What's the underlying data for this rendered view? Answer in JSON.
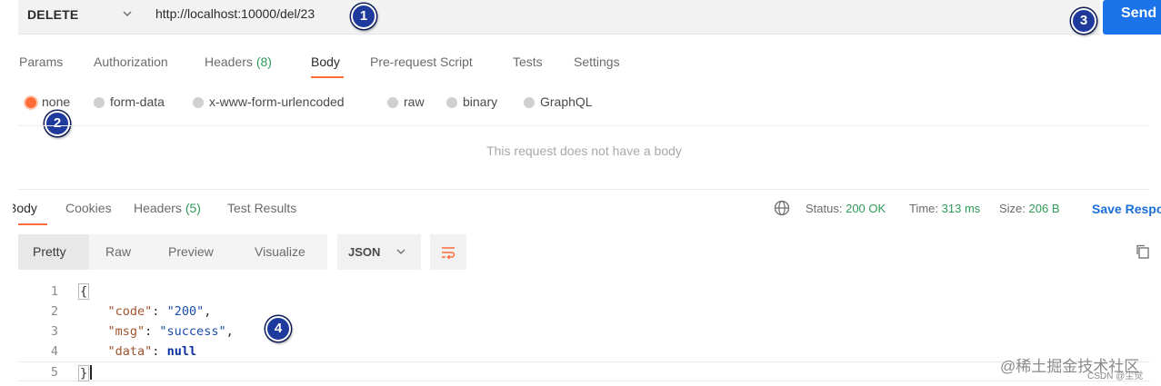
{
  "request": {
    "method": "DELETE",
    "url": "http://localhost:10000/del/23",
    "send_label": "Send"
  },
  "markers": [
    "1",
    "2",
    "3",
    "4"
  ],
  "request_tabs": [
    {
      "label": "Params"
    },
    {
      "label": "Authorization"
    },
    {
      "label": "Headers",
      "count": "(8)"
    },
    {
      "label": "Body",
      "active": true
    },
    {
      "label": "Pre-request Script"
    },
    {
      "label": "Tests"
    },
    {
      "label": "Settings"
    }
  ],
  "body_options": [
    {
      "label": "none",
      "selected": true
    },
    {
      "label": "form-data"
    },
    {
      "label": "x-www-form-urlencoded"
    },
    {
      "label": "raw"
    },
    {
      "label": "binary"
    },
    {
      "label": "GraphQL"
    }
  ],
  "empty_body_message": "This request does not have a body",
  "response": {
    "tabs": [
      {
        "label": "Body",
        "active": true
      },
      {
        "label": "Cookies"
      },
      {
        "label": "Headers",
        "count": "(5)"
      },
      {
        "label": "Test Results"
      }
    ],
    "status_label": "Status:",
    "status_value": "200 OK",
    "time_label": "Time:",
    "time_value": "313 ms",
    "size_label": "Size:",
    "size_value": "206 B",
    "save_label": "Save Response",
    "view_modes": [
      "Pretty",
      "Raw",
      "Preview",
      "Visualize"
    ],
    "active_view": "Pretty",
    "format": "JSON",
    "code_lines": [
      {
        "n": "1",
        "text": "{"
      },
      {
        "n": "2",
        "key": "\"code\"",
        "value": "\"200\"",
        "trail": ","
      },
      {
        "n": "3",
        "key": "\"msg\"",
        "value": "\"success\"",
        "trail": ","
      },
      {
        "n": "4",
        "key": "\"data\"",
        "value": "null",
        "trail": ""
      },
      {
        "n": "5",
        "text": "}"
      }
    ]
  },
  "watermark": {
    "main": "@稀土掘金技术社区",
    "sub": "CSDN @尘觉"
  },
  "colors": {
    "accent": "#ff6c37",
    "send": "#1a73e8",
    "status_green": "#2e9b58",
    "marker": "#1e3a9c"
  },
  "icons": [
    "chevron-down-icon",
    "globe-icon",
    "wrap-lines-icon",
    "copy-icon"
  ]
}
